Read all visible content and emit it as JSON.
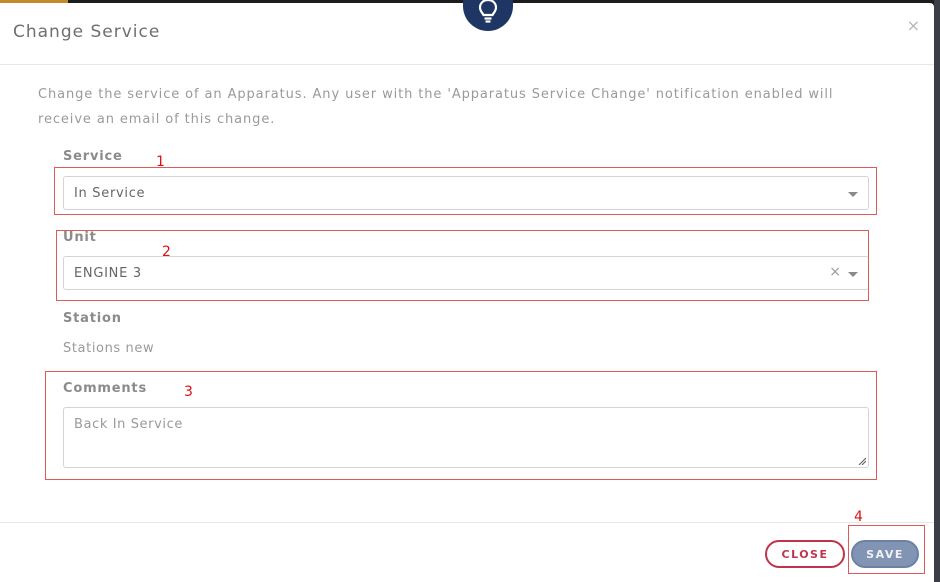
{
  "modal": {
    "title": "Change Service",
    "close_symbol": "×",
    "badge_icon": "lightbulb-icon",
    "description": "Change the service of an Apparatus. Any user with the 'Apparatus Service Change' notification enabled will receive an email of this change."
  },
  "form": {
    "service": {
      "label": "Service",
      "value": "In Service"
    },
    "unit": {
      "label": "Unit",
      "value": "ENGINE 3",
      "clear_symbol": "×"
    },
    "station": {
      "label": "Station",
      "value": "Stations new"
    },
    "comments": {
      "label": "Comments",
      "value": "Back In Service"
    }
  },
  "footer": {
    "close_label": "CLOSE",
    "save_label": "SAVE"
  },
  "annotations": {
    "n1": "1",
    "n2": "2",
    "n3": "3",
    "n4": "4"
  },
  "colors": {
    "badge": "#1f3563",
    "close_button": "#c0334d",
    "save_button": "#8294b4",
    "annotation": "#e05a5a"
  }
}
